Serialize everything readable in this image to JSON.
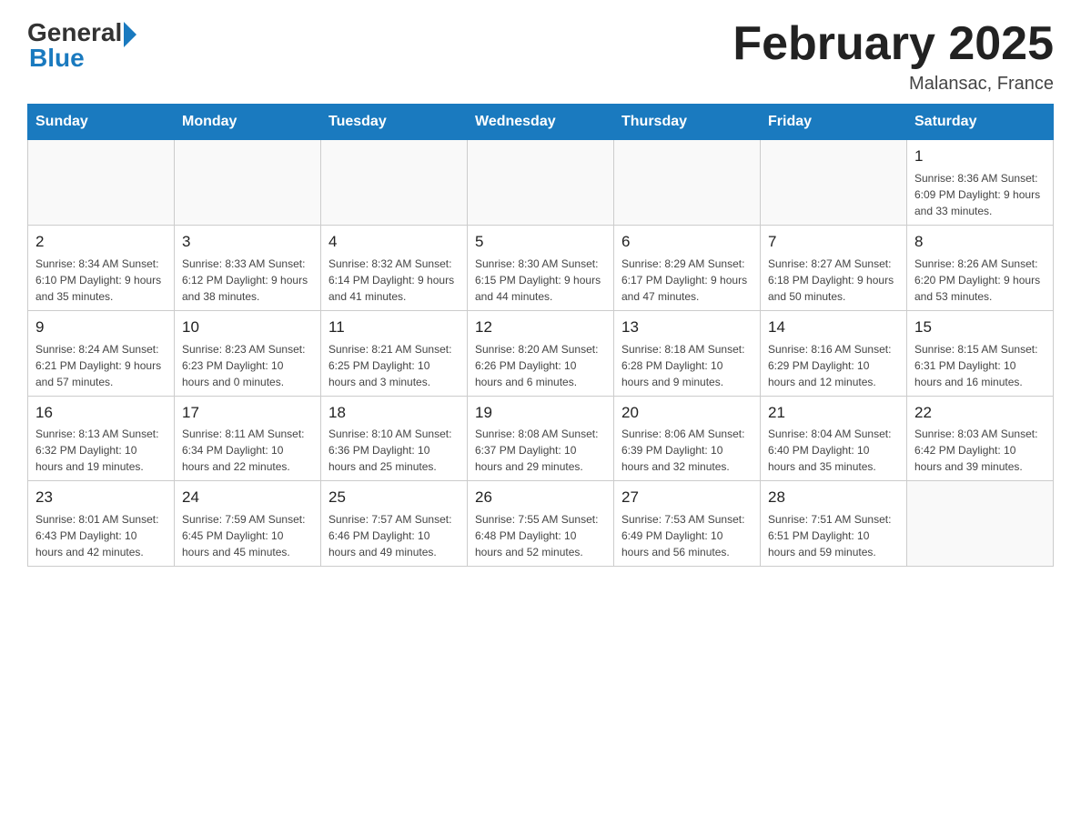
{
  "header": {
    "logo_general": "General",
    "logo_blue": "Blue",
    "title": "February 2025",
    "location": "Malansac, France"
  },
  "calendar": {
    "days_of_week": [
      "Sunday",
      "Monday",
      "Tuesday",
      "Wednesday",
      "Thursday",
      "Friday",
      "Saturday"
    ],
    "weeks": [
      [
        {
          "day": "",
          "info": ""
        },
        {
          "day": "",
          "info": ""
        },
        {
          "day": "",
          "info": ""
        },
        {
          "day": "",
          "info": ""
        },
        {
          "day": "",
          "info": ""
        },
        {
          "day": "",
          "info": ""
        },
        {
          "day": "1",
          "info": "Sunrise: 8:36 AM\nSunset: 6:09 PM\nDaylight: 9 hours and 33 minutes."
        }
      ],
      [
        {
          "day": "2",
          "info": "Sunrise: 8:34 AM\nSunset: 6:10 PM\nDaylight: 9 hours and 35 minutes."
        },
        {
          "day": "3",
          "info": "Sunrise: 8:33 AM\nSunset: 6:12 PM\nDaylight: 9 hours and 38 minutes."
        },
        {
          "day": "4",
          "info": "Sunrise: 8:32 AM\nSunset: 6:14 PM\nDaylight: 9 hours and 41 minutes."
        },
        {
          "day": "5",
          "info": "Sunrise: 8:30 AM\nSunset: 6:15 PM\nDaylight: 9 hours and 44 minutes."
        },
        {
          "day": "6",
          "info": "Sunrise: 8:29 AM\nSunset: 6:17 PM\nDaylight: 9 hours and 47 minutes."
        },
        {
          "day": "7",
          "info": "Sunrise: 8:27 AM\nSunset: 6:18 PM\nDaylight: 9 hours and 50 minutes."
        },
        {
          "day": "8",
          "info": "Sunrise: 8:26 AM\nSunset: 6:20 PM\nDaylight: 9 hours and 53 minutes."
        }
      ],
      [
        {
          "day": "9",
          "info": "Sunrise: 8:24 AM\nSunset: 6:21 PM\nDaylight: 9 hours and 57 minutes."
        },
        {
          "day": "10",
          "info": "Sunrise: 8:23 AM\nSunset: 6:23 PM\nDaylight: 10 hours and 0 minutes."
        },
        {
          "day": "11",
          "info": "Sunrise: 8:21 AM\nSunset: 6:25 PM\nDaylight: 10 hours and 3 minutes."
        },
        {
          "day": "12",
          "info": "Sunrise: 8:20 AM\nSunset: 6:26 PM\nDaylight: 10 hours and 6 minutes."
        },
        {
          "day": "13",
          "info": "Sunrise: 8:18 AM\nSunset: 6:28 PM\nDaylight: 10 hours and 9 minutes."
        },
        {
          "day": "14",
          "info": "Sunrise: 8:16 AM\nSunset: 6:29 PM\nDaylight: 10 hours and 12 minutes."
        },
        {
          "day": "15",
          "info": "Sunrise: 8:15 AM\nSunset: 6:31 PM\nDaylight: 10 hours and 16 minutes."
        }
      ],
      [
        {
          "day": "16",
          "info": "Sunrise: 8:13 AM\nSunset: 6:32 PM\nDaylight: 10 hours and 19 minutes."
        },
        {
          "day": "17",
          "info": "Sunrise: 8:11 AM\nSunset: 6:34 PM\nDaylight: 10 hours and 22 minutes."
        },
        {
          "day": "18",
          "info": "Sunrise: 8:10 AM\nSunset: 6:36 PM\nDaylight: 10 hours and 25 minutes."
        },
        {
          "day": "19",
          "info": "Sunrise: 8:08 AM\nSunset: 6:37 PM\nDaylight: 10 hours and 29 minutes."
        },
        {
          "day": "20",
          "info": "Sunrise: 8:06 AM\nSunset: 6:39 PM\nDaylight: 10 hours and 32 minutes."
        },
        {
          "day": "21",
          "info": "Sunrise: 8:04 AM\nSunset: 6:40 PM\nDaylight: 10 hours and 35 minutes."
        },
        {
          "day": "22",
          "info": "Sunrise: 8:03 AM\nSunset: 6:42 PM\nDaylight: 10 hours and 39 minutes."
        }
      ],
      [
        {
          "day": "23",
          "info": "Sunrise: 8:01 AM\nSunset: 6:43 PM\nDaylight: 10 hours and 42 minutes."
        },
        {
          "day": "24",
          "info": "Sunrise: 7:59 AM\nSunset: 6:45 PM\nDaylight: 10 hours and 45 minutes."
        },
        {
          "day": "25",
          "info": "Sunrise: 7:57 AM\nSunset: 6:46 PM\nDaylight: 10 hours and 49 minutes."
        },
        {
          "day": "26",
          "info": "Sunrise: 7:55 AM\nSunset: 6:48 PM\nDaylight: 10 hours and 52 minutes."
        },
        {
          "day": "27",
          "info": "Sunrise: 7:53 AM\nSunset: 6:49 PM\nDaylight: 10 hours and 56 minutes."
        },
        {
          "day": "28",
          "info": "Sunrise: 7:51 AM\nSunset: 6:51 PM\nDaylight: 10 hours and 59 minutes."
        },
        {
          "day": "",
          "info": ""
        }
      ]
    ]
  }
}
